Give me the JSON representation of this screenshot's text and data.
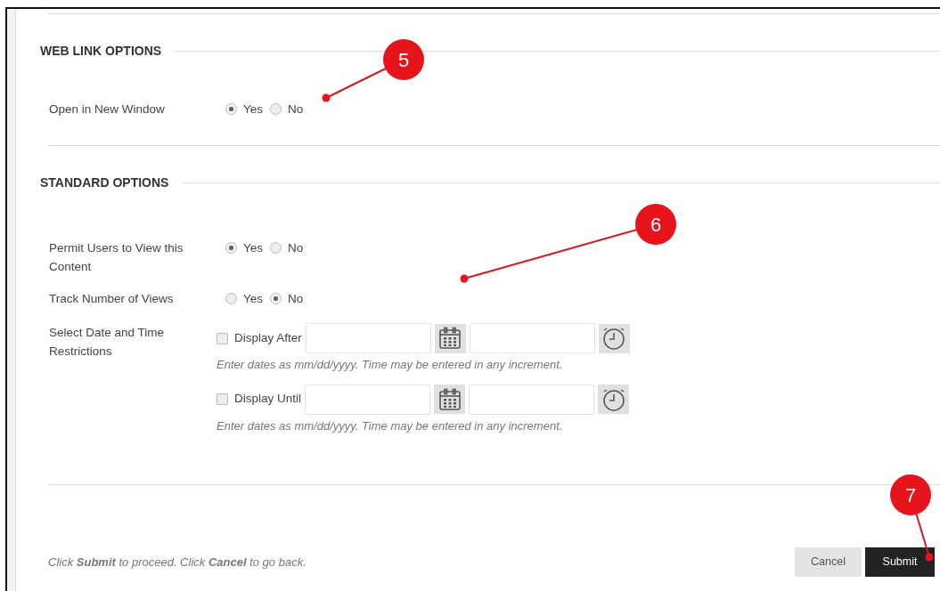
{
  "sections": [
    {
      "title": "WEB LINK OPTIONS",
      "rows": [
        {
          "kind": "radio",
          "label": "Open in New Window",
          "options": [
            {
              "label": "Yes",
              "selected": true
            },
            {
              "label": "No",
              "selected": false
            }
          ]
        }
      ]
    },
    {
      "title": "STANDARD OPTIONS",
      "rows": [
        {
          "kind": "radio",
          "label": "Permit Users to View this Content",
          "options": [
            {
              "label": "Yes",
              "selected": true
            },
            {
              "label": "No",
              "selected": false
            }
          ]
        },
        {
          "kind": "radio",
          "label": "Track Number of Views",
          "options": [
            {
              "label": "Yes",
              "selected": false
            },
            {
              "label": "No",
              "selected": true
            }
          ]
        },
        {
          "kind": "dates",
          "label": "Select Date and Time Restrictions",
          "entries": [
            {
              "label": "Display After",
              "checked": false,
              "hint": "Enter dates as mm/dd/yyyy. Time may be entered in any increment."
            },
            {
              "label": "Display Until",
              "checked": false,
              "hint": "Enter dates as mm/dd/yyyy. Time may be entered in any increment."
            }
          ]
        }
      ]
    }
  ],
  "footer": {
    "instruction": "Click **Submit** to proceed. Click **Cancel** to go back.",
    "buttons": [
      {
        "label": "Cancel",
        "kind": "secondary"
      },
      {
        "label": "Submit",
        "kind": "primary"
      }
    ]
  },
  "callouts": [
    {
      "number": "5"
    },
    {
      "number": "6"
    },
    {
      "number": "7"
    }
  ]
}
